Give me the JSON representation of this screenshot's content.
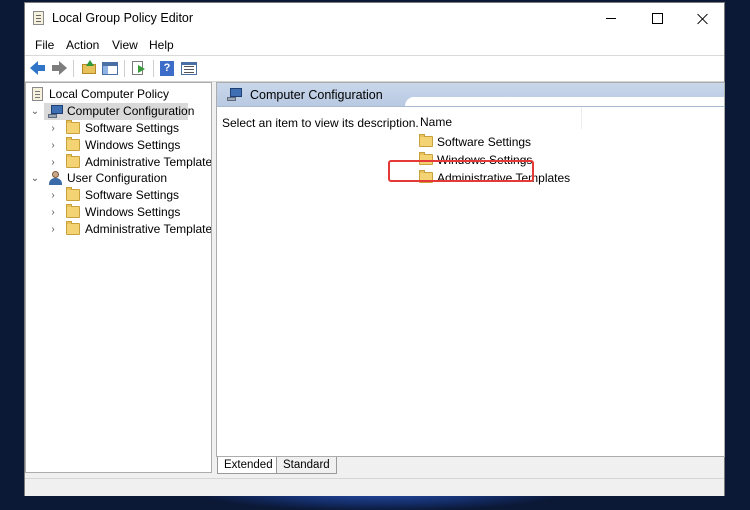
{
  "window": {
    "title": "Local Group Policy Editor"
  },
  "menu": {
    "items": [
      "File",
      "Action",
      "View",
      "Help"
    ]
  },
  "toolbar": {
    "buttons": [
      "back-icon",
      "forward-icon",
      "up-folder-icon",
      "show-hide-tree-icon",
      "export-list-icon",
      "help-icon",
      "properties-icon"
    ]
  },
  "tree": {
    "root": "Local Computer Policy",
    "computer": {
      "label": "Computer Configuration",
      "children": [
        "Software Settings",
        "Windows Settings",
        "Administrative Templates"
      ]
    },
    "user": {
      "label": "User Configuration",
      "children": [
        "Software Settings",
        "Windows Settings",
        "Administrative Templates"
      ]
    }
  },
  "content": {
    "header": "Computer Configuration",
    "description": "Select an item to view its description.",
    "column_name": "Name",
    "items": [
      "Software Settings",
      "Windows Settings",
      "Administrative Templates"
    ]
  },
  "tabs": [
    "Extended",
    "Standard"
  ],
  "colors": {
    "highlight": "#e53935",
    "folder": "#f3d374",
    "header": "#c9d7ea"
  }
}
